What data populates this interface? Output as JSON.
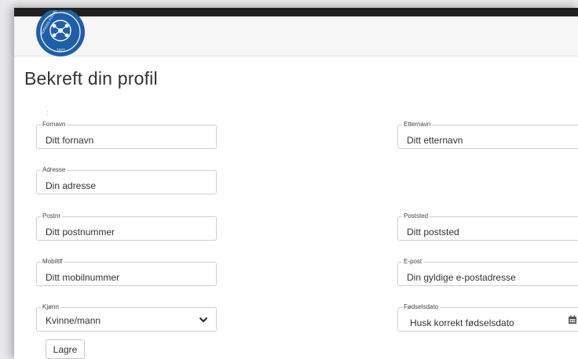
{
  "header": {
    "logo_text": "NORGES FORBUND",
    "logo_year": "1971"
  },
  "page": {
    "title": "Bekreft din profil",
    "stray_mark": ":"
  },
  "form": {
    "first_name": {
      "label": "Fornavn",
      "placeholder": "Ditt fornavn"
    },
    "last_name": {
      "label": "Etternavn",
      "placeholder": "Ditt etternavn"
    },
    "address": {
      "label": "Adresse",
      "placeholder": "Din adresse"
    },
    "postal_code": {
      "label": "Postnr",
      "placeholder": "Ditt postnummer"
    },
    "postal_place": {
      "label": "Poststed",
      "placeholder": "Ditt poststed"
    },
    "mobile": {
      "label": "Mobiltlf",
      "placeholder": "Ditt mobilnummer"
    },
    "email": {
      "label": "E-post",
      "placeholder": "Din gyldige e-postadresse"
    },
    "gender": {
      "label": "Kjønn",
      "selected": "Kvinne/mann"
    },
    "birthdate": {
      "label": "Fødselsdato",
      "placeholder": "Husk korrekt fødselsdato"
    },
    "save_label": "Lagre"
  },
  "colors": {
    "topbar": "#212121",
    "header_bg": "#f6f6f7",
    "logo_blue": "#1f5fa8",
    "border": "#cfcfcf"
  },
  "icons": {
    "logo": "federation-emblem-icon",
    "select": "chevron-down-icon",
    "date": "calendar-icon"
  }
}
